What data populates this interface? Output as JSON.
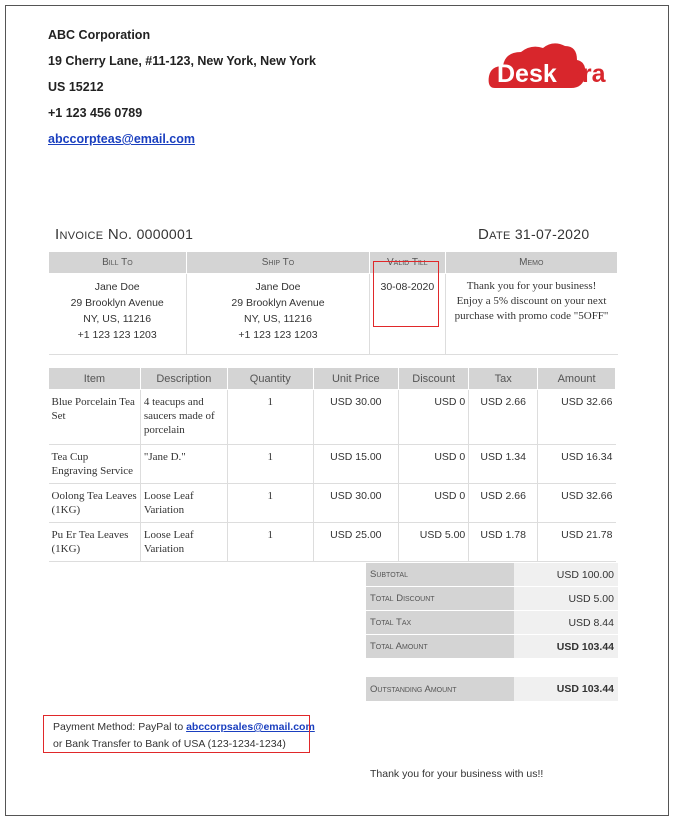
{
  "company": {
    "name": "ABC Corporation",
    "address1": "19 Cherry Lane, #11-123,  New York, New York",
    "address2": "US 15212",
    "phone": "+1 123 456 0789",
    "email": "abccorpteas@email.com"
  },
  "logo": {
    "text_red": "Desk",
    "text_red2": "era",
    "brand_color": "#d8262c"
  },
  "invoice": {
    "number_label": "Invoice No.",
    "number": "0000001",
    "date_label": "Date",
    "date": "31-07-2020"
  },
  "meta": {
    "headers": {
      "bill_to": "Bill To",
      "ship_to": "Ship To",
      "valid_till": "Valid Till",
      "memo": "Memo"
    },
    "bill_to": [
      "Jane Doe",
      "29 Brooklyn Avenue",
      "NY, US, 11216",
      "+1 123 123 1203"
    ],
    "ship_to": [
      "Jane Doe",
      "29 Brooklyn Avenue",
      "NY, US, 11216",
      "+1 123 123 1203"
    ],
    "valid_till": "30-08-2020",
    "memo": [
      "Thank you for your business!",
      "Enjoy a 5% discount on your next",
      "purchase with promo code \"5OFF\""
    ]
  },
  "items": {
    "headers": [
      "Item",
      "Description",
      "Quantity",
      "Unit Price",
      "Discount",
      "Tax",
      "Amount"
    ],
    "rows": [
      [
        "Blue Porcelain Tea Set",
        "4 teacups and saucers made of porcelain",
        "1",
        "USD 30.00",
        "USD 0",
        "USD 2.66",
        "USD 32.66"
      ],
      [
        "Tea Cup Engraving Service",
        "\"Jane D.\"",
        "1",
        "USD 15.00",
        "USD 0",
        "USD 1.34",
        "USD 16.34"
      ],
      [
        "Oolong Tea Leaves (1KG)",
        "Loose Leaf Variation",
        "1",
        "USD 30.00",
        "USD 0",
        "USD 2.66",
        "USD 32.66"
      ],
      [
        "Pu Er Tea Leaves (1KG)",
        "Loose Leaf Variation",
        "1",
        "USD 25.00",
        "USD 5.00",
        "USD 1.78",
        "USD 21.78"
      ]
    ]
  },
  "totals": {
    "subtotal_label": "Subtotal",
    "subtotal": "USD 100.00",
    "discount_label": "Total Discount",
    "discount": "USD 5.00",
    "tax_label": "Total Tax",
    "tax": "USD 8.44",
    "amount_label": "Total Amount",
    "amount": "USD 103.44",
    "outstanding_label": "Outstanding Amount",
    "outstanding": "USD 103.44"
  },
  "payment": {
    "line1_prefix": "Payment Method: PayPal to ",
    "line1_email": "abccorpsales@email.com",
    "line2": "or Bank Transfer to Bank of USA (123-1234-1234)"
  },
  "footer": {
    "thanks": "Thank you for your business with us!!"
  },
  "colors": {
    "highlight": "#e0282a",
    "link": "#1a3fbf",
    "header_bg": "#d4d4d4"
  }
}
